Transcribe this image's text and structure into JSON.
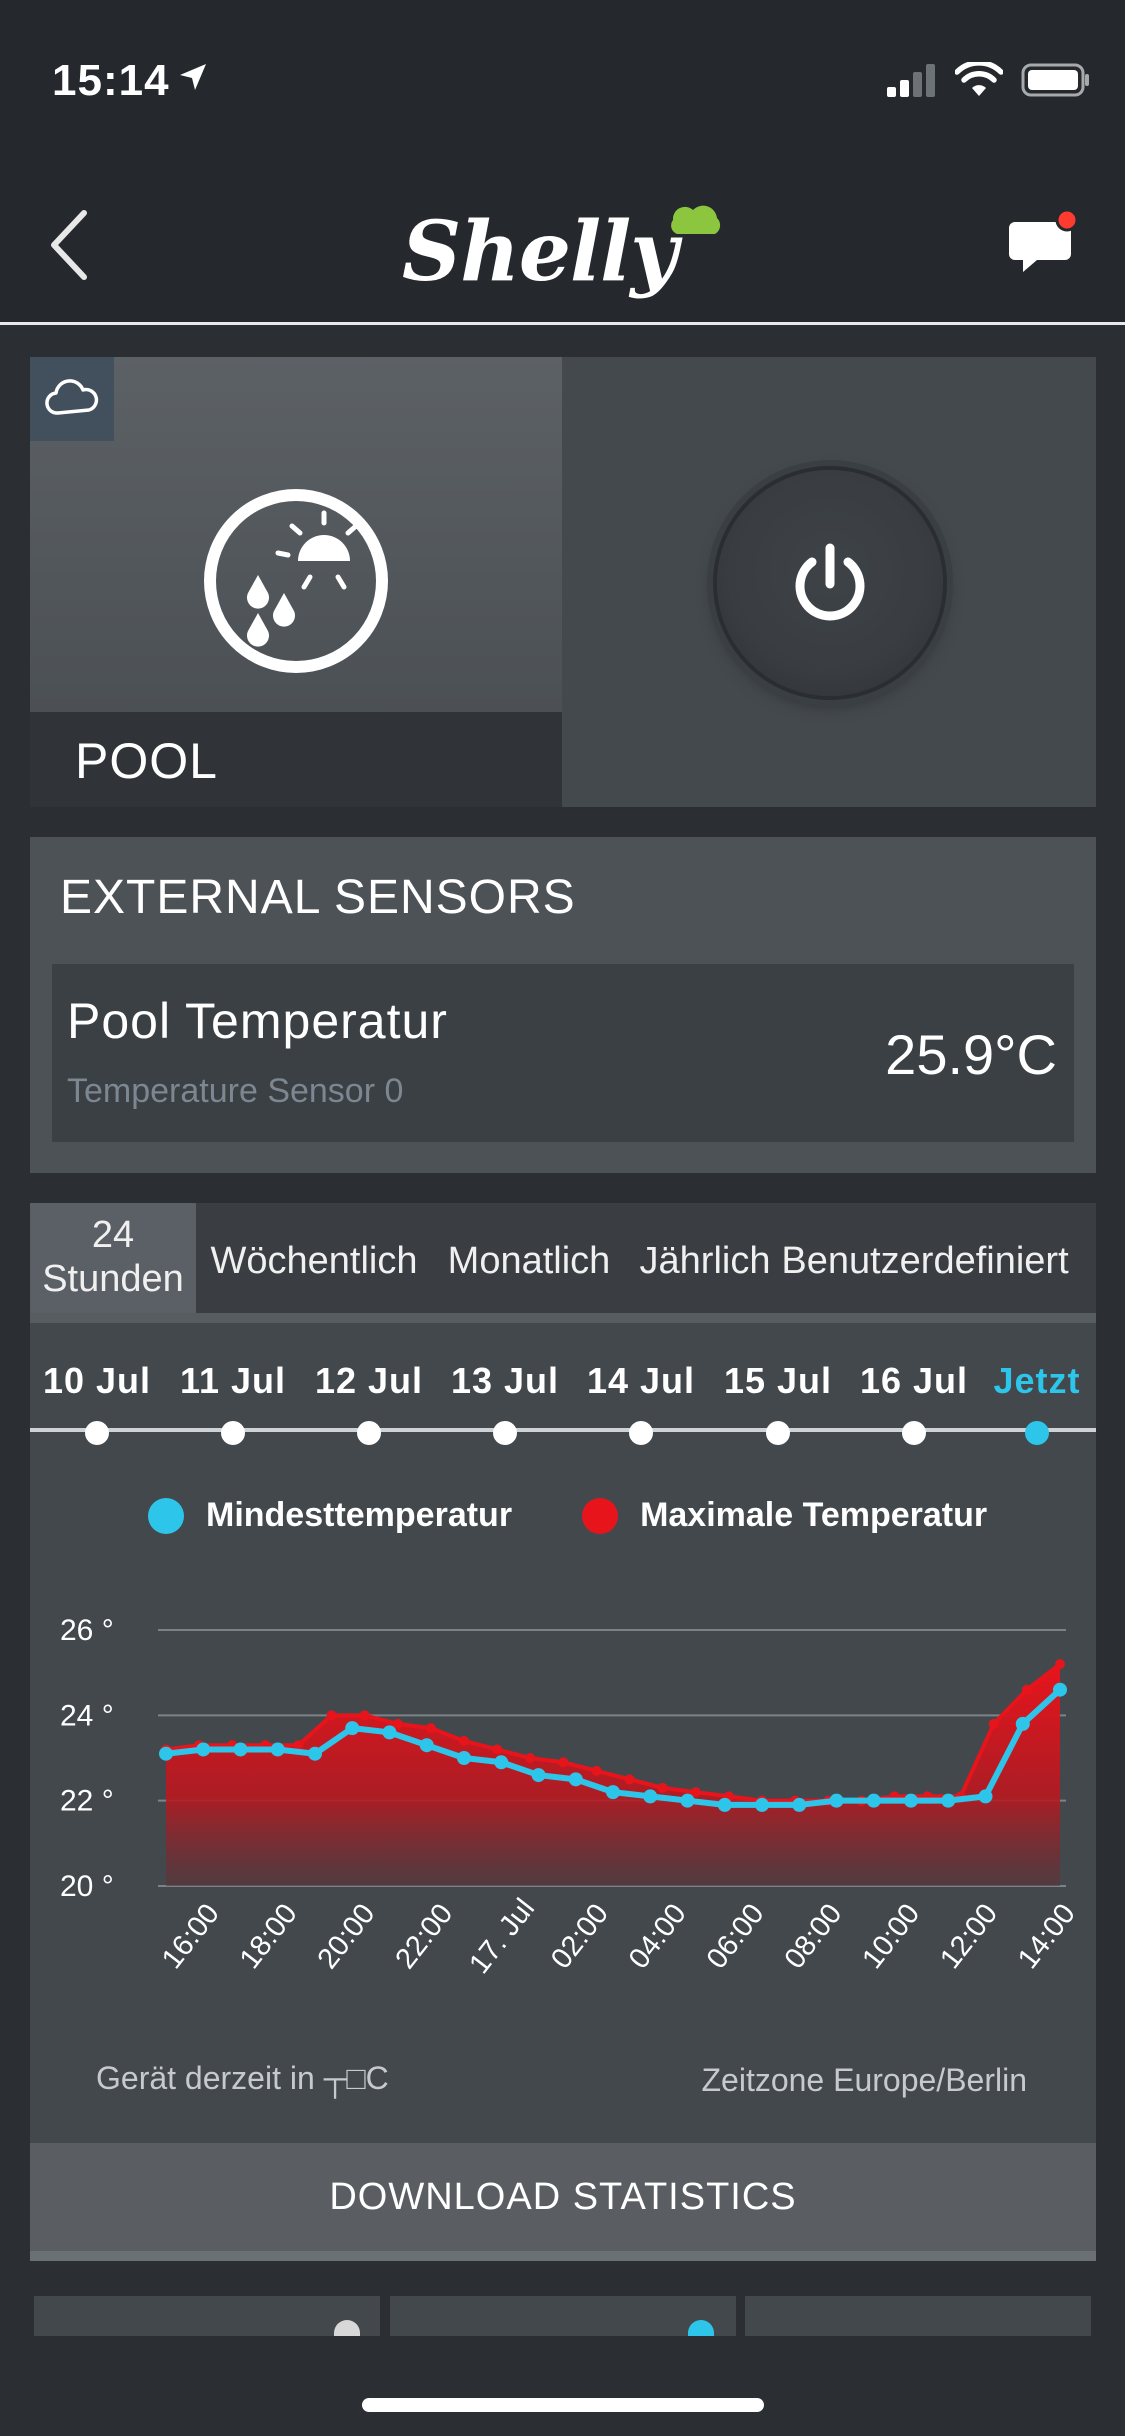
{
  "status_bar": {
    "time": "15:14"
  },
  "header": {
    "logo_text": "Shelly"
  },
  "device": {
    "name": "POOL"
  },
  "sensors": {
    "title": "EXTERNAL SENSORS",
    "name": "Pool Temperatur",
    "subtitle": "Temperature Sensor 0",
    "value": "25.9°C"
  },
  "tabs": [
    {
      "line1": "24",
      "line2": "Stunden"
    },
    {
      "label": "Wöchentlich"
    },
    {
      "label": "Monatlich"
    },
    {
      "label": "Jährlich"
    },
    {
      "label": "Benutzerdefiniert"
    }
  ],
  "dates": [
    "10 Jul",
    "11 Jul",
    "12 Jul",
    "13 Jul",
    "14 Jul",
    "15 Jul",
    "16 Jul",
    "Jetzt"
  ],
  "legend": {
    "min_label": "Mindesttemperatur",
    "max_label": "Maximale Temperatur"
  },
  "chart_data": {
    "type": "area",
    "ylim": [
      20,
      26
    ],
    "yticks": [
      "26 °",
      "24 °",
      "22 °",
      "20 °"
    ],
    "ytick_values": [
      26,
      24,
      22,
      20
    ],
    "xticks": [
      "16:00",
      "18:00",
      "20:00",
      "22:00",
      "17. Jul",
      "02:00",
      "04:00",
      "06:00",
      "08:00",
      "10:00",
      "12:00",
      "14:00"
    ],
    "series": [
      {
        "name": "Maximale Temperatur",
        "color": "#e8141c",
        "values": [
          23.2,
          23.3,
          23.3,
          23.3,
          23.3,
          24.0,
          24.0,
          23.8,
          23.7,
          23.4,
          23.2,
          23.0,
          22.9,
          22.7,
          22.5,
          22.3,
          22.2,
          22.1,
          22.0,
          22.0,
          22.0,
          22.0,
          22.1,
          22.1,
          22.1,
          23.8,
          24.6,
          25.2
        ]
      },
      {
        "name": "Mindesttemperatur",
        "color": "#2dc6ea",
        "values": [
          23.1,
          23.2,
          23.2,
          23.2,
          23.1,
          23.7,
          23.6,
          23.3,
          23.0,
          22.9,
          22.6,
          22.5,
          22.2,
          22.1,
          22.0,
          21.9,
          21.9,
          21.9,
          22.0,
          22.0,
          22.0,
          22.0,
          22.1,
          23.8,
          24.6
        ]
      }
    ]
  },
  "footer": {
    "left": "Gerät derzeit in ┬□C",
    "right": "Zeitzone Europe/Berlin"
  },
  "download_label": "DOWNLOAD STATISTICS",
  "colors": {
    "accent": "#2dc6ea",
    "max": "#e8141c",
    "notification": "#ff3b30",
    "logo_cloud": "#8cc63f"
  }
}
